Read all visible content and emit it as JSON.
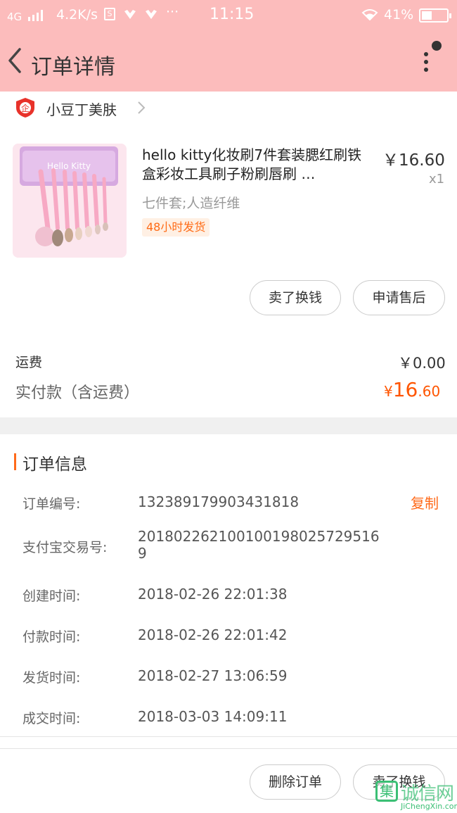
{
  "status_bar": {
    "network": "4G",
    "speed": "4.2K/s",
    "more": "···",
    "time": "11:15",
    "battery": "41%"
  },
  "header": {
    "title": "订单详情"
  },
  "shop": {
    "name": "小豆丁美肤",
    "badge_glyph": "企"
  },
  "product": {
    "title": "hello kitty化妆刷7件套装腮红刷铁盒彩妆工具刷子粉刷唇刷 …",
    "price": "￥16.60",
    "quantity": "x1",
    "sku": "七件套;人造纤维",
    "shipping_badge": "48小时发货"
  },
  "actions": {
    "sell": "卖了换钱",
    "after_sale": "申请售后"
  },
  "fees": {
    "shipping_label": "运费",
    "shipping_value": "￥0.00",
    "paid_label": "实付款（含运费）",
    "paid_symbol": "¥",
    "paid_int": "16",
    "paid_dec": ".60"
  },
  "order_info": {
    "title": "订单信息",
    "copy": "复制",
    "rows": [
      {
        "label": "订单编号:",
        "value": "132389179903431818"
      },
      {
        "label": "支付宝交易号:",
        "value": "2018022621001001980257295169"
      },
      {
        "label": "创建时间:",
        "value": "2018-02-26 22:01:38"
      },
      {
        "label": "付款时间:",
        "value": "2018-02-26 22:01:42"
      },
      {
        "label": "发货时间:",
        "value": "2018-02-27 13:06:59"
      },
      {
        "label": "成交时间:",
        "value": "2018-03-03 14:09:11"
      }
    ]
  },
  "bottom": {
    "delete": "删除订单",
    "sell": "卖了换钱"
  },
  "watermark": {
    "glyph": "集",
    "text": "诚信网",
    "sub": "JiChengXin.com"
  },
  "colors": {
    "header_bg": "#fcbcbc",
    "accent": "#ff6a1a",
    "price_red": "#ff5500"
  }
}
